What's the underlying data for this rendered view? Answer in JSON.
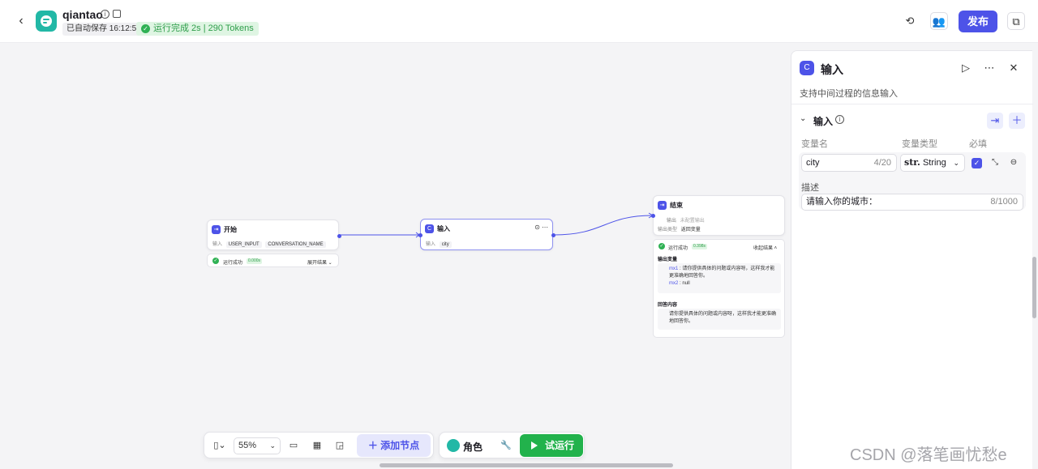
{
  "header": {
    "app_name": "qiantao",
    "autosave": "已自动保存 16:12:51",
    "run_status": "运行完成 2s | 290 Tokens",
    "publish_label": "发布"
  },
  "canvas": {
    "nodes": {
      "start": {
        "title": "开始",
        "inputs_label": "输入",
        "vars": [
          "USER_INPUT",
          "CONVERSATION_NAME"
        ],
        "result": {
          "status": "运行成功",
          "time": "0.000s",
          "toggle": "展开结果"
        }
      },
      "input": {
        "title": "输入",
        "inputs_label": "输入",
        "vars": [
          "city"
        ]
      },
      "end": {
        "title": "结束",
        "output_label": "输出",
        "output_value": "未配置输出",
        "output_type_label": "输出类型",
        "output_type_value": "返回变量",
        "result": {
          "status": "运行成功",
          "time": "0.398s",
          "toggle": "收起结果",
          "output_vars_title": "输出变量",
          "mx1_key": "mx1",
          "mx1_value": "请你提供具体的问题或内容呀，这样我才能更准确地回答你。",
          "mx2_key": "mx2",
          "mx2_value": "null",
          "answer_title": "回答内容",
          "answer_value": "请你提供具体的问题或内容呀，这样我才能更准确地回答你。"
        }
      }
    }
  },
  "toolbar": {
    "zoom": "55%",
    "add_node_label": "添加节点",
    "role_label": "角色",
    "trial_run_label": "试运行"
  },
  "panel": {
    "title": "输入",
    "description": "支持中间过程的信息输入",
    "section_title": "输入",
    "col_name": "变量名",
    "col_type": "变量类型",
    "col_required": "必填",
    "var_name": "city",
    "var_name_count": "4/20",
    "var_type_prefix": "str.",
    "var_type": "String",
    "desc_label": "描述",
    "desc_value": "请输入你的城市：",
    "desc_count": "8/1000"
  },
  "watermark": "CSDN @落笔画忧愁e",
  "colors": {
    "accent": "#4d53e8",
    "success": "#22b24c",
    "app_icon": "#22b8a6"
  }
}
